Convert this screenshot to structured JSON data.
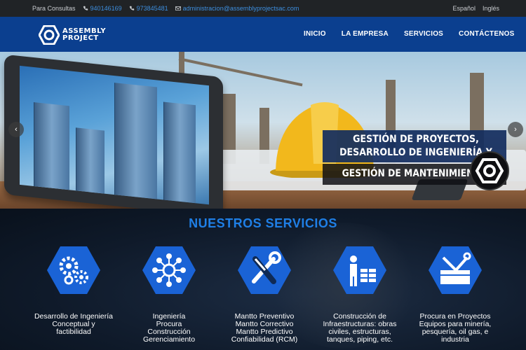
{
  "topbar": {
    "contact_label": "Para Consultas",
    "phone1": "940146169",
    "phone2": "973845481",
    "email": "administracion@assemblyprojectsac.com",
    "languages": [
      "Español",
      "Inglés"
    ]
  },
  "header": {
    "logo_line1": "ASSEMBLY",
    "logo_line2": "PROJECT",
    "menu": [
      "INICIO",
      "LA EMPRESA",
      "SERVICIOS",
      "CONTÁCTENOS"
    ]
  },
  "hero": {
    "line1": "GESTIÓN DE PROYECTOS,",
    "line2": "DESARROLLO DE  INGENIERÍA Y",
    "line3": "GESTIÓN DE MANTENIMIENTO",
    "prev": "‹",
    "next": "›"
  },
  "services": {
    "title": "NUESTROS SERVICIOS",
    "items": [
      {
        "icon": "gears-icon",
        "label": "Desarrollo de Ingeniería\nConceptual y\nfactibilidad"
      },
      {
        "icon": "network-icon",
        "label": "Ingeniería\nProcura\nConstrucción\nGerenciamiento"
      },
      {
        "icon": "tools-icon",
        "label": "Mantto Preventivo\nMantto Correctivo\nMantto Predictivo\nConfiabilidad (RCM)"
      },
      {
        "icon": "worker-icon",
        "label": "Construcción de\nInfraestructuras: obras\nciviles, estructuras,\ntanques, piping, etc."
      },
      {
        "icon": "toolbox-icon",
        "label": "Procura en Proyectos\nEquipos para minería,\npesquería, oil gas, e\nindustria"
      }
    ]
  },
  "colors": {
    "nav_blue": "#0b3f8f",
    "accent_blue": "#1f7fe6",
    "hex_blue": "#1a63d6"
  }
}
